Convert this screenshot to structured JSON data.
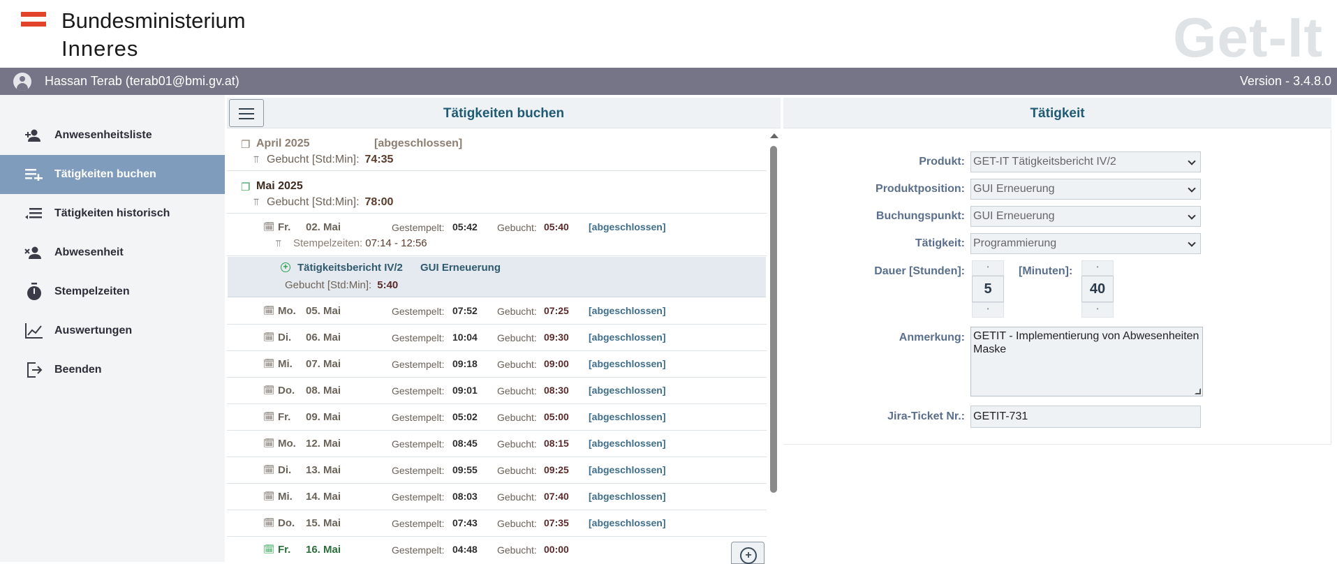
{
  "header": {
    "ministry_line1": "Bundesministerium",
    "ministry_line2": "Inneres",
    "brand": "Get-It"
  },
  "userbar": {
    "user": "Hassan Terab (terab01@bmi.gv.at)",
    "version": "Version - 3.4.8.0"
  },
  "sidebar": {
    "items": [
      {
        "label": "Anwesenheitsliste",
        "icon": "add-person-icon",
        "active": false
      },
      {
        "label": "Tätigkeiten buchen",
        "icon": "playlist-add-icon",
        "active": true
      },
      {
        "label": "Tätigkeiten historisch",
        "icon": "history-list-icon",
        "active": false
      },
      {
        "label": "Abwesenheit",
        "icon": "person-remove-icon",
        "active": false
      },
      {
        "label": "Stempelzeiten",
        "icon": "timer-icon",
        "active": false
      },
      {
        "label": "Auswertungen",
        "icon": "chart-line-icon",
        "active": false
      },
      {
        "label": "Beenden",
        "icon": "logout-icon",
        "active": false
      }
    ]
  },
  "middle": {
    "title": "Tätigkeiten buchen",
    "months": [
      {
        "name": "April 2025",
        "status": "[abgeschlossen]",
        "booked_label": "Gebucht [Std:Min]:",
        "booked": "74:35"
      },
      {
        "name": "Mai 2025",
        "status": "",
        "booked_label": "Gebucht [Std:Min]:",
        "booked": "78:00"
      }
    ],
    "labels": {
      "stamped": "Gestempelt:",
      "booked": "Gebucht:",
      "closed": "[abgeschlossen]",
      "stamp_times": "Stempelzeiten:"
    },
    "first_day": {
      "weekday": "Fr.",
      "date": "02. Mai",
      "stamped": "05:42",
      "booked": "05:40",
      "status": "[abgeschlossen]",
      "stamp_times": "07:14 - 12:56"
    },
    "activity": {
      "title": "Tätigkeitsbericht IV/2",
      "position": "GUI Erneuerung",
      "booked_label": "Gebucht [Std:Min]:",
      "booked": "5:40"
    },
    "days": [
      {
        "weekday": "Mo.",
        "date": "05. Mai",
        "stamped": "07:52",
        "booked": "07:25",
        "status": "[abgeschlossen]"
      },
      {
        "weekday": "Di.",
        "date": "06. Mai",
        "stamped": "10:04",
        "booked": "09:30",
        "status": "[abgeschlossen]"
      },
      {
        "weekday": "Mi.",
        "date": "07. Mai",
        "stamped": "09:18",
        "booked": "09:00",
        "status": "[abgeschlossen]"
      },
      {
        "weekday": "Do.",
        "date": "08. Mai",
        "stamped": "09:01",
        "booked": "08:30",
        "status": "[abgeschlossen]"
      },
      {
        "weekday": "Fr.",
        "date": "09. Mai",
        "stamped": "05:02",
        "booked": "05:00",
        "status": "[abgeschlossen]"
      },
      {
        "weekday": "Mo.",
        "date": "12. Mai",
        "stamped": "08:45",
        "booked": "08:15",
        "status": "[abgeschlossen]"
      },
      {
        "weekday": "Di.",
        "date": "13. Mai",
        "stamped": "09:55",
        "booked": "09:25",
        "status": "[abgeschlossen]"
      },
      {
        "weekday": "Mi.",
        "date": "14. Mai",
        "stamped": "08:03",
        "booked": "07:40",
        "status": "[abgeschlossen]"
      },
      {
        "weekday": "Do.",
        "date": "15. Mai",
        "stamped": "07:43",
        "booked": "07:35",
        "status": "[abgeschlossen]"
      },
      {
        "weekday": "Fr.",
        "date": "16. Mai",
        "stamped": "04:48",
        "booked": "00:00",
        "status": ""
      }
    ]
  },
  "detail": {
    "title": "Tätigkeit",
    "product_label": "Produkt:",
    "product": "GET-IT Tätigkeitsbericht IV/2",
    "position_label": "Produktposition:",
    "position": "GUI Erneuerung",
    "booking_label": "Buchungspunkt:",
    "booking": "GUI Erneuerung",
    "activity_label": "Tätigkeit:",
    "activity": "Programmierung",
    "duration_hours_label": "Dauer [Stunden]:",
    "duration_hours": "5",
    "duration_minutes_label": "[Minuten]:",
    "duration_minutes": "40",
    "note_label": "Anmerkung:",
    "note": "GETIT - Implementierung von Abwesenheiten Maske",
    "jira_label": "Jira-Ticket Nr.:",
    "jira": "GETIT-731"
  },
  "colors": {
    "userbar": "#757587",
    "active_nav": "#7f9cbd",
    "title": "#1f5a73",
    "brand": "#dfe3e6",
    "flag_red": "#e2432b"
  }
}
